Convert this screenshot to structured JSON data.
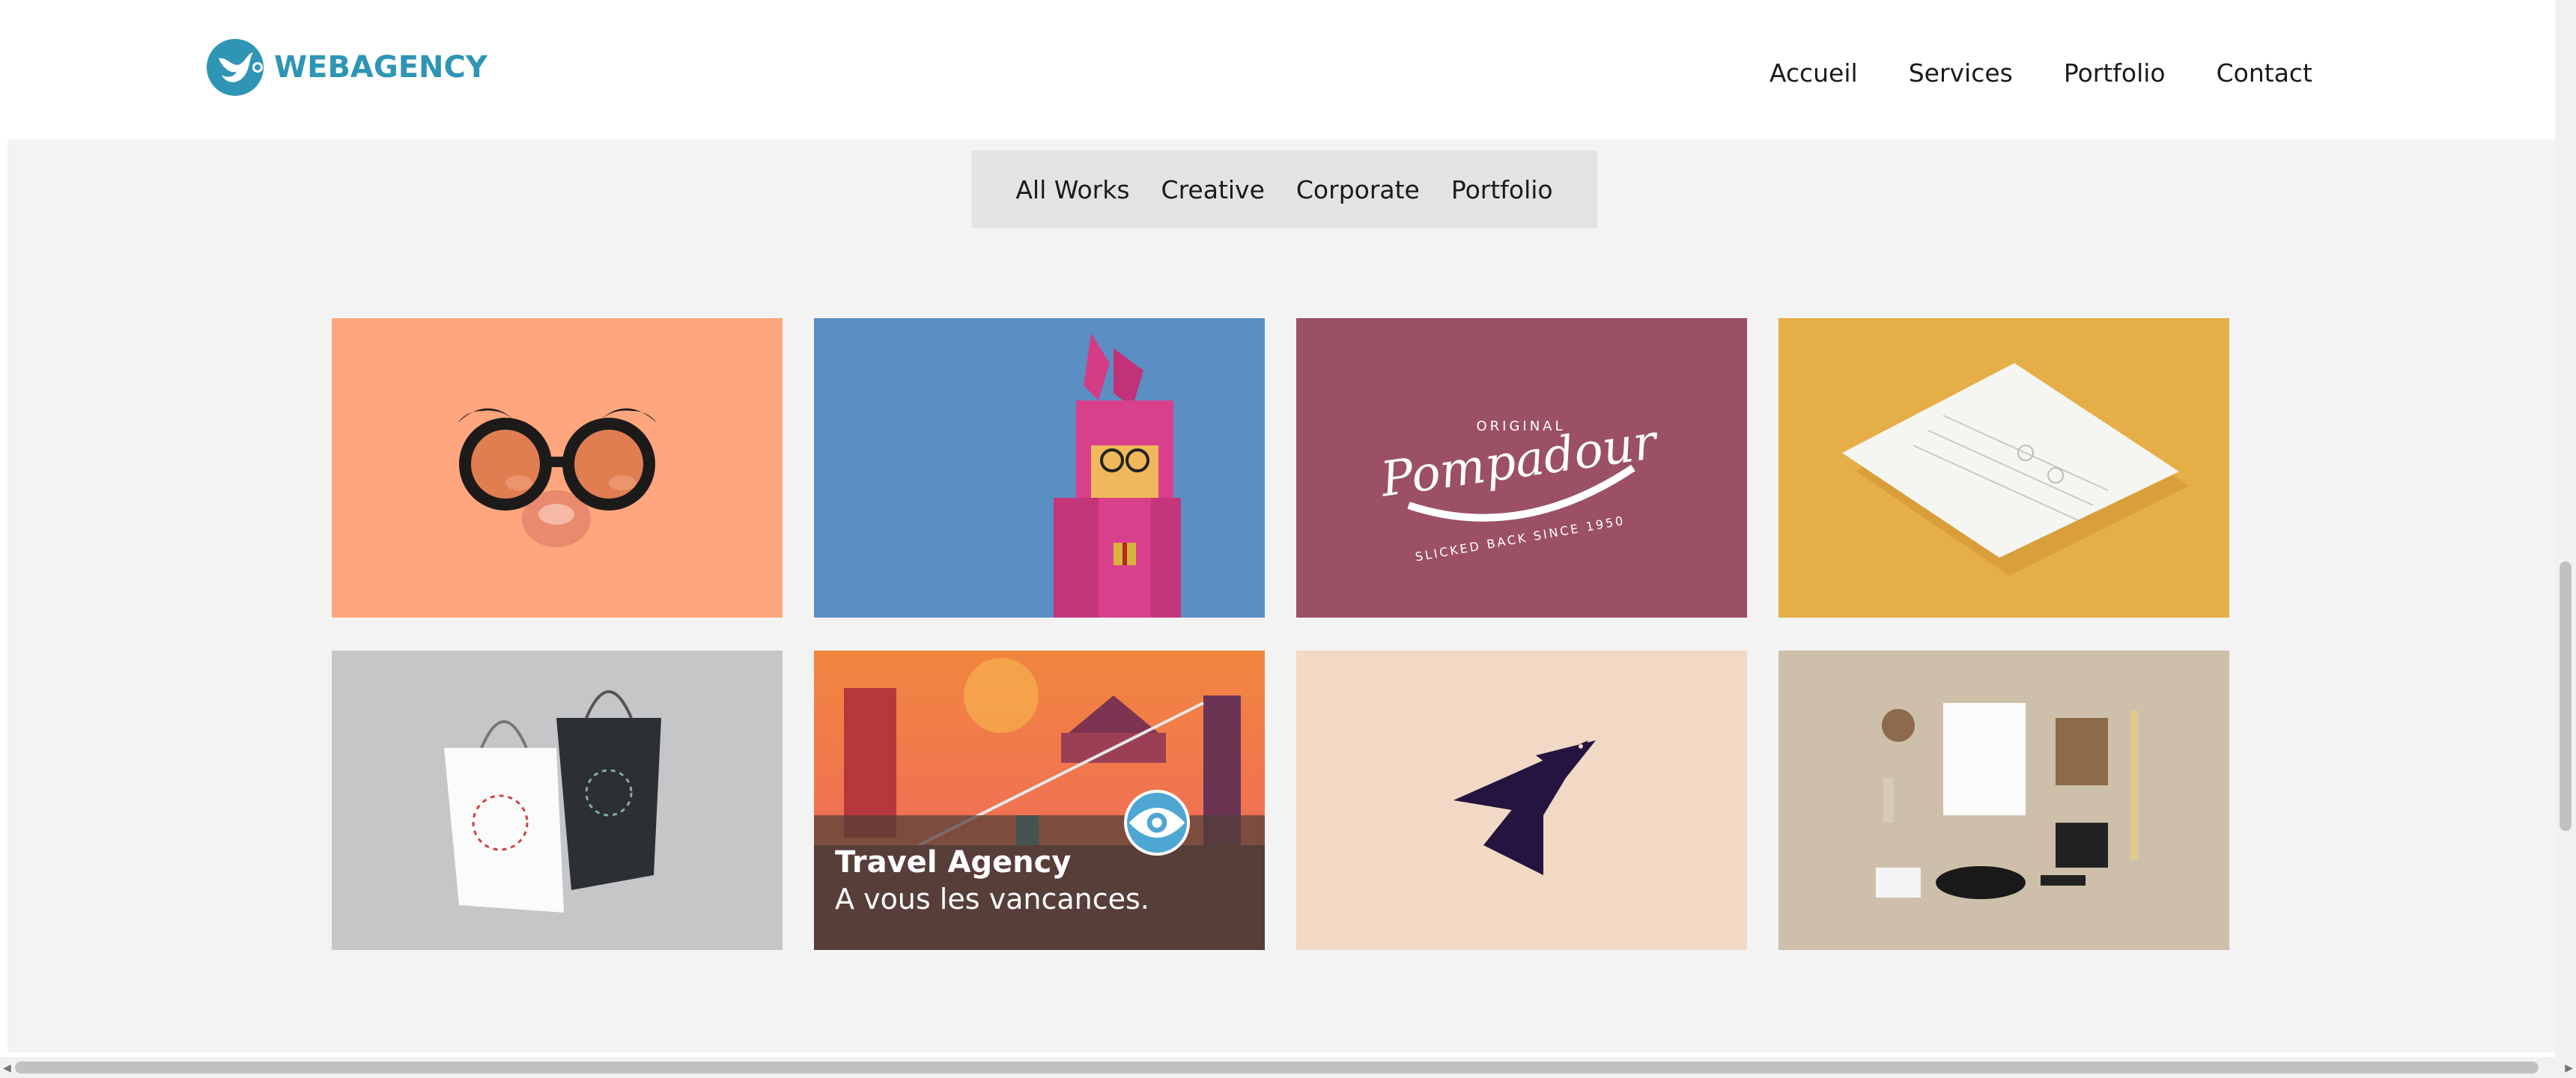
{
  "brand": {
    "name": "WEBAGENCY",
    "color": "#2f95b4"
  },
  "nav": {
    "items": [
      "Accueil",
      "Services",
      "Portfolio",
      "Contact"
    ]
  },
  "filters": {
    "items": [
      "All Works",
      "Creative",
      "Corporate",
      "Portfolio"
    ]
  },
  "portfolio": {
    "tiles": [
      {
        "subject": "glasses-disguise",
        "bg": "#ffa67e"
      },
      {
        "subject": "pink-bunny-illustration",
        "bg": "#5b8fc4"
      },
      {
        "subject": "pompadour-logo",
        "bg": "#9b5064",
        "logo_lines": [
          "ORIGINAL",
          "Pompadour",
          "SLICKED BACK SINCE 1950"
        ]
      },
      {
        "subject": "stationery-paper",
        "bg": "#e6ae47"
      },
      {
        "subject": "shopping-bags",
        "bg": "#c5c6c8"
      },
      {
        "subject": "city-sunset-illustration",
        "bg": "#f07a4a",
        "hover_title": "Travel Agency",
        "hover_subtitle": "A vous les vancances."
      },
      {
        "subject": "bird-logo",
        "bg": "#f1d9c6"
      },
      {
        "subject": "branding-mockup",
        "bg": "#cdbfa9"
      }
    ]
  }
}
